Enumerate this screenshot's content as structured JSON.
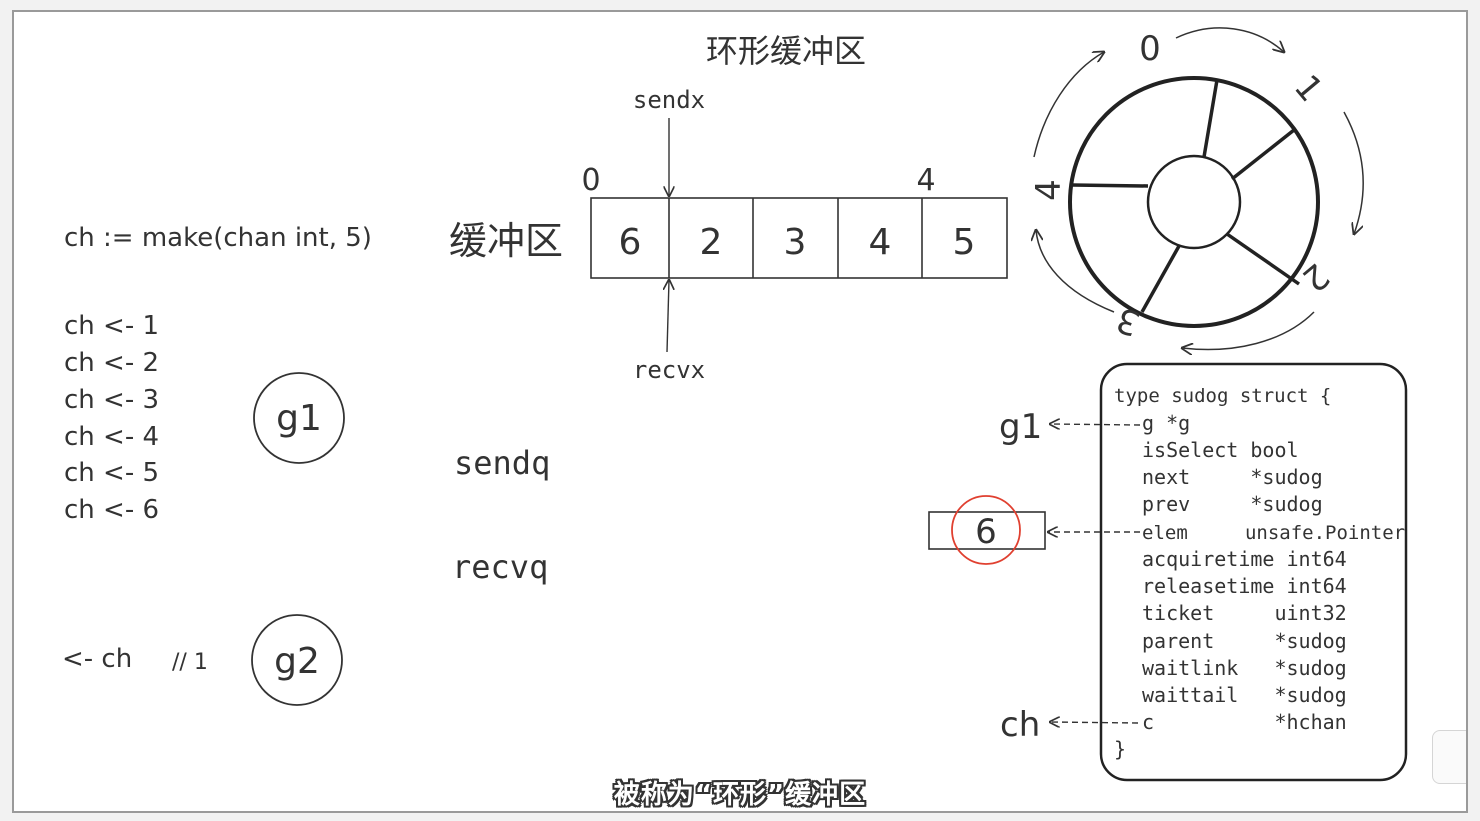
{
  "title": "环形缓冲区",
  "buffer": {
    "label": "缓冲区",
    "cells": [
      "6",
      "2",
      "3",
      "4",
      "5"
    ],
    "start_index": "0",
    "end_index": "4",
    "sendx_label": "sendx",
    "recvx_label": "recvx"
  },
  "code": {
    "make": "ch := make(chan int, 5)",
    "sends": [
      "ch <- 1",
      "ch <- 2",
      "ch <- 3",
      "ch <- 4",
      "ch <- 5",
      "ch <- 6"
    ],
    "recv": "<- ch",
    "recv_comment": "// 1"
  },
  "goroutines": {
    "g1": "g1",
    "g2": "g2"
  },
  "queues": {
    "sendq": "sendq",
    "recvq": "recvq"
  },
  "ring": {
    "labels": [
      "0",
      "1",
      "2",
      "3",
      "4"
    ]
  },
  "sudog": {
    "lines": [
      "type sudog struct {",
      "g *g",
      "isSelect bool",
      "next     *sudog",
      "prev     *sudog",
      "elem     unsafe.Pointer",
      "acquiretime int64",
      "releasetime int64",
      "ticket     uint32",
      "parent     *sudog",
      "waitlink   *sudog",
      "waittail   *sudog",
      "c          *hchan",
      "}"
    ],
    "g_ref": "g1",
    "elem_value": "6",
    "c_ref": "ch"
  },
  "subtitle": "被称为“环形”缓冲区",
  "colors": {
    "highlight_circle": "#e04030",
    "ink": "#333333"
  }
}
